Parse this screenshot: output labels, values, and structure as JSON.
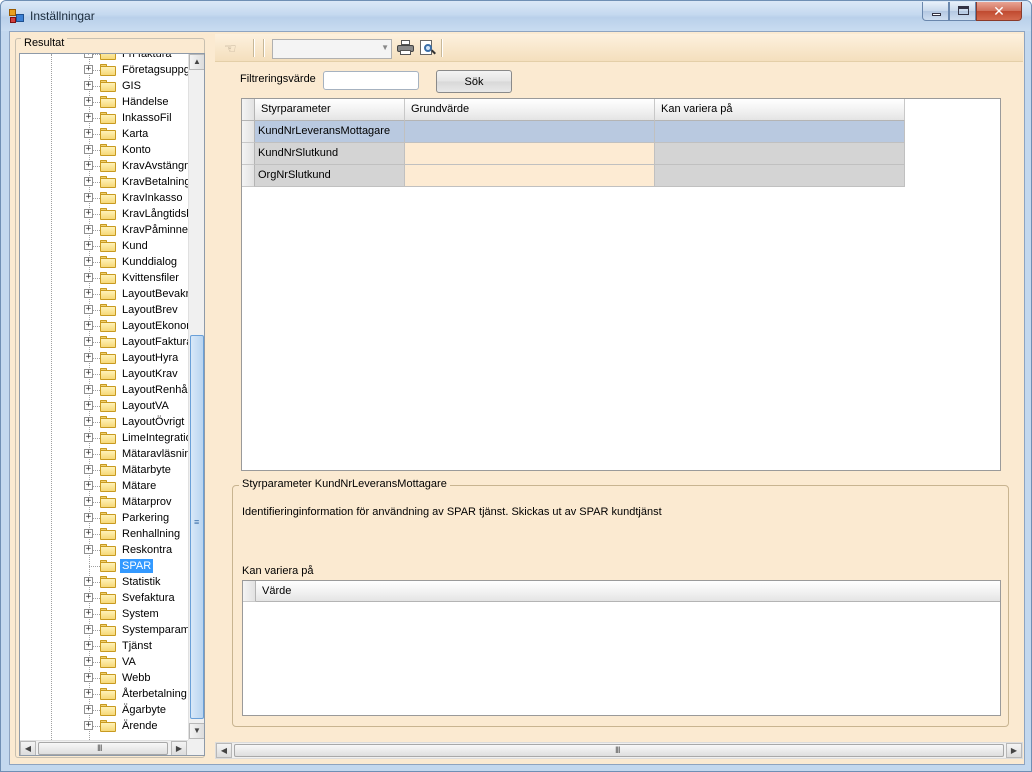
{
  "window": {
    "title": "Inställningar"
  },
  "left_panel": {
    "group_label": "Resultat",
    "tree_items": [
      {
        "label": "Fri faktura",
        "expandable": true
      },
      {
        "label": "Företagsuppgift",
        "expandable": true
      },
      {
        "label": "GIS",
        "expandable": true
      },
      {
        "label": "Händelse",
        "expandable": true
      },
      {
        "label": "InkassoFil",
        "expandable": true
      },
      {
        "label": "Karta",
        "expandable": true
      },
      {
        "label": "Konto",
        "expandable": true
      },
      {
        "label": "KravAvstängnir",
        "expandable": true
      },
      {
        "label": "KravBetalningst",
        "expandable": true
      },
      {
        "label": "KravInkasso",
        "expandable": true
      },
      {
        "label": "KravLångtidsbe",
        "expandable": true
      },
      {
        "label": "KravPåminnelse",
        "expandable": true
      },
      {
        "label": "Kund",
        "expandable": true
      },
      {
        "label": "Kunddialog",
        "expandable": true
      },
      {
        "label": "Kvittensfiler",
        "expandable": true
      },
      {
        "label": "LayoutBevaknir",
        "expandable": true
      },
      {
        "label": "LayoutBrev",
        "expandable": true
      },
      {
        "label": "LayoutEkonomi",
        "expandable": true
      },
      {
        "label": "LayoutFaktura",
        "expandable": true
      },
      {
        "label": "LayoutHyra",
        "expandable": true
      },
      {
        "label": "LayoutKrav",
        "expandable": true
      },
      {
        "label": "LayoutRenhålln",
        "expandable": true
      },
      {
        "label": "LayoutVA",
        "expandable": true
      },
      {
        "label": "LayoutÖvrigt",
        "expandable": true
      },
      {
        "label": "LimeIntegration",
        "expandable": true
      },
      {
        "label": "Mätaravläsning",
        "expandable": true
      },
      {
        "label": "Mätarbyte",
        "expandable": true
      },
      {
        "label": "Mätare",
        "expandable": true
      },
      {
        "label": "Mätarprov",
        "expandable": true
      },
      {
        "label": "Parkering",
        "expandable": true
      },
      {
        "label": "Renhallning",
        "expandable": true
      },
      {
        "label": "Reskontra",
        "expandable": true
      },
      {
        "label": "SPAR",
        "expandable": false,
        "selected": true
      },
      {
        "label": "Statistik",
        "expandable": true
      },
      {
        "label": "Svefaktura",
        "expandable": true
      },
      {
        "label": "System",
        "expandable": true
      },
      {
        "label": "Systemparamet",
        "expandable": true
      },
      {
        "label": "Tjänst",
        "expandable": true
      },
      {
        "label": "VA",
        "expandable": true
      },
      {
        "label": "Webb",
        "expandable": true
      },
      {
        "label": "Återbetalning",
        "expandable": true
      },
      {
        "label": "Ägarbyte",
        "expandable": true
      },
      {
        "label": "Ärende",
        "expandable": true
      }
    ],
    "scroll_glyph_up": "▲",
    "scroll_glyph_down": "▼",
    "scroll_glyph_left": "◀",
    "scroll_glyph_right": "▶",
    "grip_v": "≡",
    "grip_h": "III"
  },
  "toolbar": {
    "icons": [
      "hand-icon",
      "printer-icon",
      "print-preview-icon"
    ],
    "combo_value": ""
  },
  "filter": {
    "label": "Filtreringsvärde",
    "value": "",
    "search_label": "Sök"
  },
  "grid": {
    "columns": [
      "Styrparameter",
      "Grundvärde",
      "Kan variera på"
    ],
    "rows": [
      {
        "styrparameter": "KundNrLeveransMottagare",
        "grundvarde": "",
        "kan_variera": "",
        "selected": true
      },
      {
        "styrparameter": "KundNrSlutkund",
        "grundvarde": "",
        "kan_variera": ""
      },
      {
        "styrparameter": "OrgNrSlutkund",
        "grundvarde": "",
        "kan_variera": ""
      }
    ]
  },
  "details": {
    "group_label": "Styrparameter KundNrLeveransMottagare",
    "description": "Identifieringinformation för användning av SPAR tjänst. Skickas ut av SPAR kundtjänst",
    "vary_label": "Kan variera på",
    "sub_columns": [
      "Värde"
    ]
  },
  "colors": {
    "selected_row": "#b9c9e0",
    "cell_bg": "#fdebd3",
    "cell_gray": "#d4d4d4",
    "tree_selected": "#3399ff",
    "panel_bg": "#fbead1"
  }
}
